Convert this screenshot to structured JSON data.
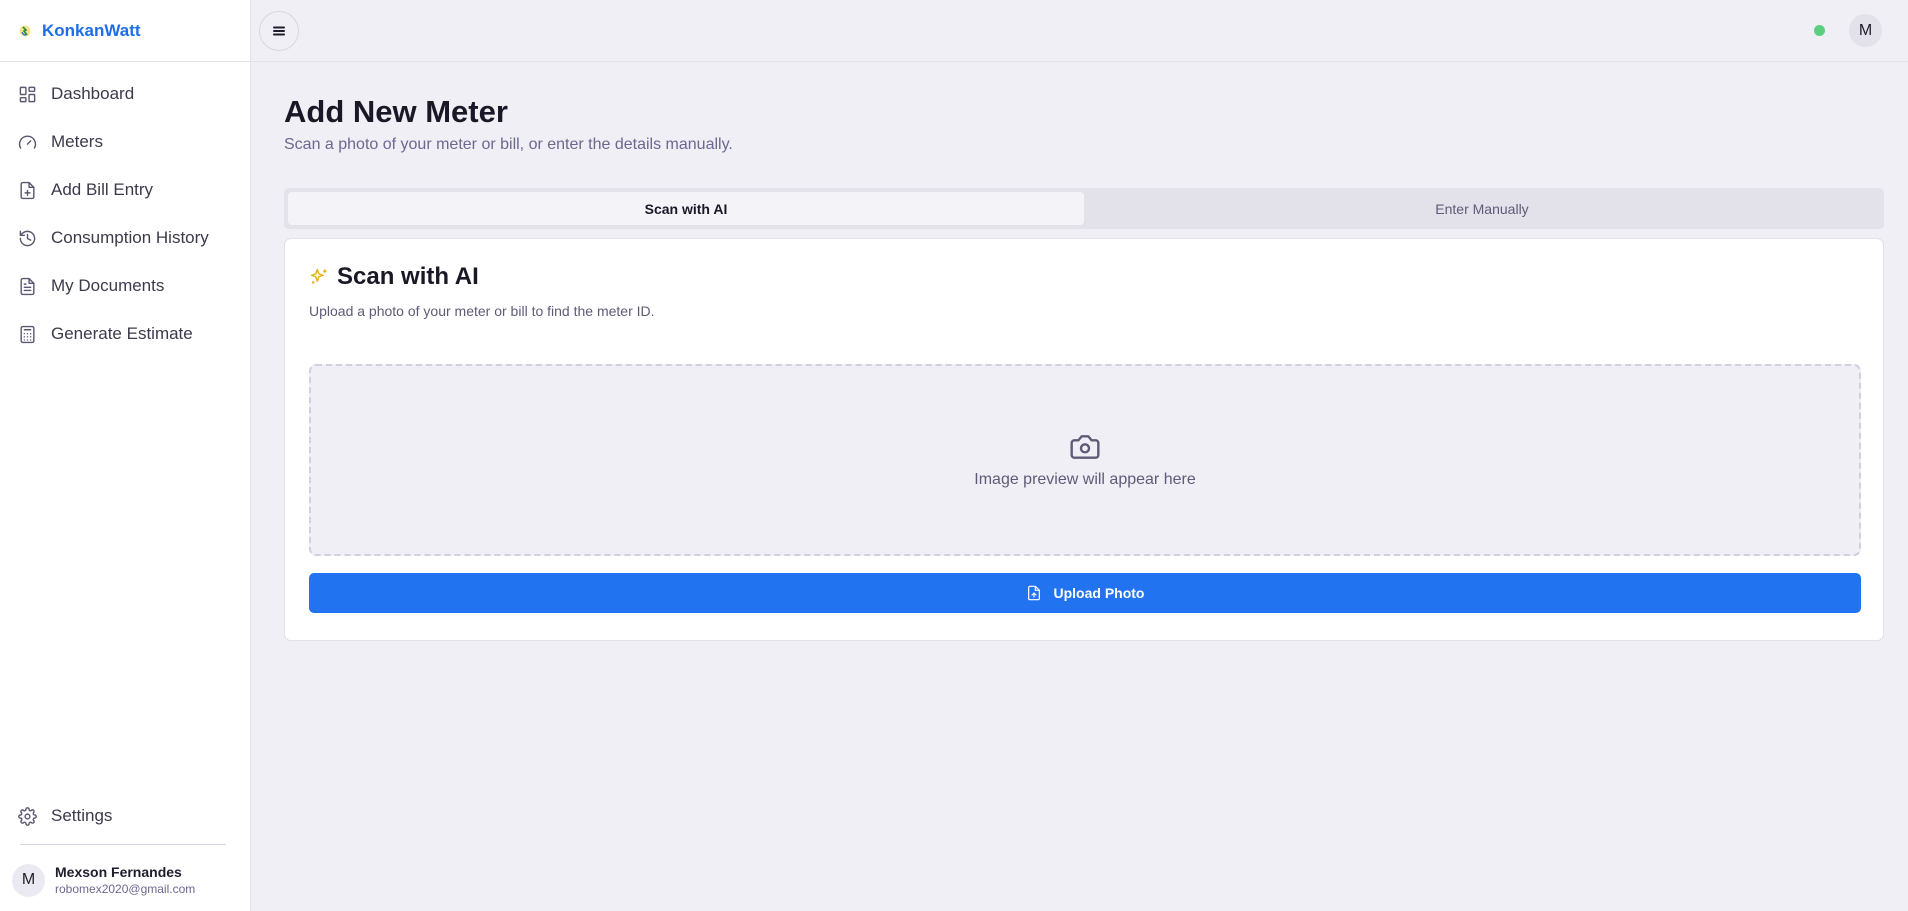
{
  "brand": {
    "name": "KonkanWatt"
  },
  "sidebar": {
    "items": [
      {
        "label": "Dashboard",
        "icon": "dashboard-icon"
      },
      {
        "label": "Meters",
        "icon": "gauge-icon"
      },
      {
        "label": "Add Bill Entry",
        "icon": "file-plus-icon"
      },
      {
        "label": "Consumption History",
        "icon": "history-icon"
      },
      {
        "label": "My Documents",
        "icon": "document-icon"
      },
      {
        "label": "Generate Estimate",
        "icon": "calculator-icon"
      }
    ],
    "settings_label": "Settings",
    "user": {
      "initial": "M",
      "name": "Mexson Fernandes",
      "email": "robomex2020@gmail.com"
    }
  },
  "topbar": {
    "avatar_initial": "M",
    "status_color": "#5ccf7e"
  },
  "main": {
    "title": "Add New Meter",
    "subtitle": "Scan a photo of your meter or bill, or enter the details manually.",
    "tabs": [
      {
        "label": "Scan with AI",
        "active": true
      },
      {
        "label": "Enter Manually",
        "active": false
      }
    ],
    "card": {
      "title": "Scan with AI",
      "description": "Upload a photo of your meter or bill to find the meter ID.",
      "preview_text": "Image preview will appear here",
      "upload_label": "Upload Photo"
    }
  },
  "colors": {
    "accent": "#2273ef",
    "brand": "#1d6ee8",
    "sparkle": "#e6b422"
  }
}
